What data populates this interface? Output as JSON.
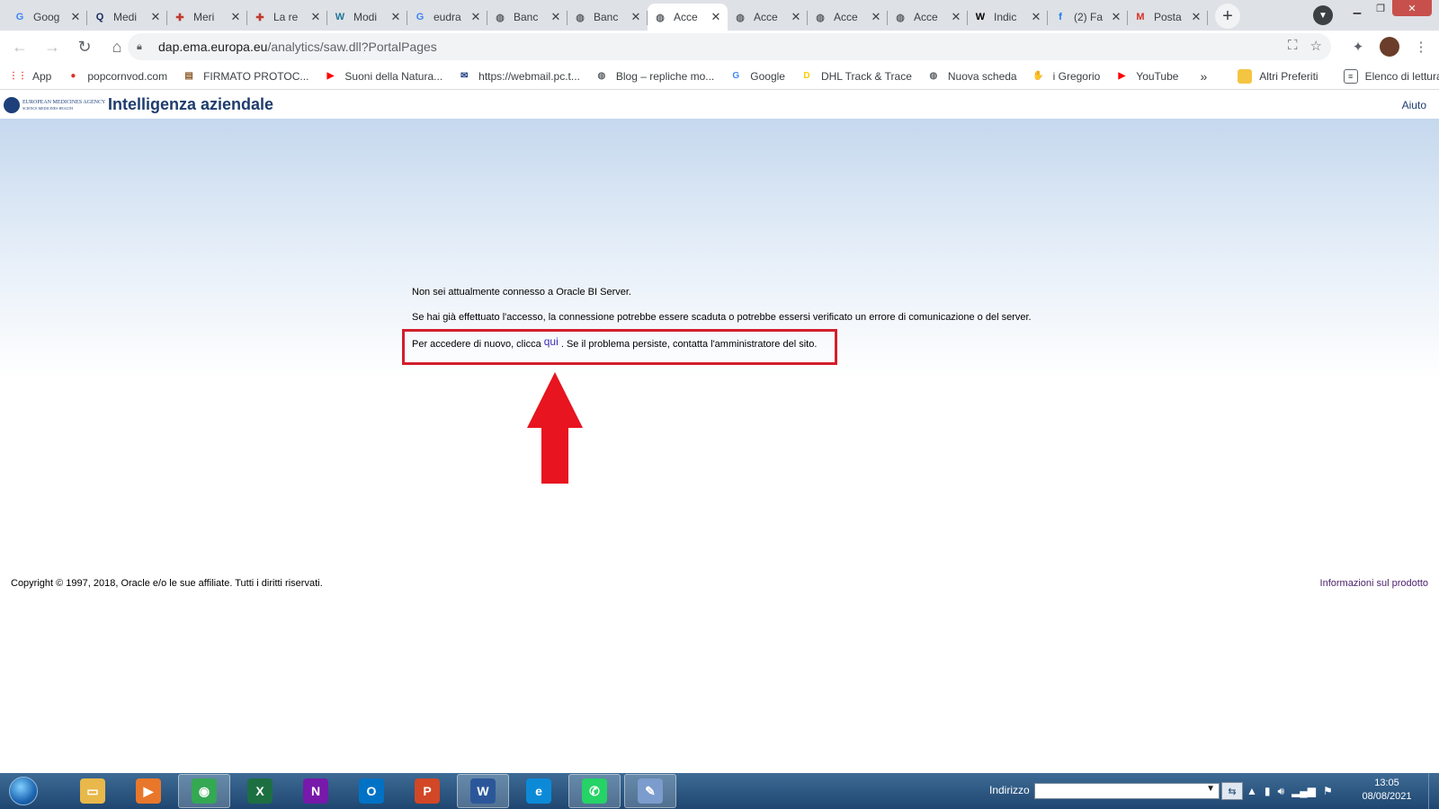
{
  "tabs": [
    {
      "label": "Goog",
      "icon": "google-icon",
      "color": "#4285f4",
      "glyph": "G"
    },
    {
      "label": "Medi",
      "icon": "search-q-icon",
      "color": "#1a2b5e",
      "glyph": "Q"
    },
    {
      "label": "Meri",
      "icon": "ministry-icon",
      "color": "#c0392b",
      "glyph": "✚"
    },
    {
      "label": "La re",
      "icon": "ministry-icon",
      "color": "#c0392b",
      "glyph": "✚"
    },
    {
      "label": "Modi",
      "icon": "wordpress-icon",
      "color": "#21759b",
      "glyph": "W"
    },
    {
      "label": "eudra",
      "icon": "google-icon",
      "color": "#4285f4",
      "glyph": "G"
    },
    {
      "label": "Banc",
      "icon": "globe-icon",
      "color": "#5f6368",
      "glyph": "◍"
    },
    {
      "label": "Banc",
      "icon": "globe-icon",
      "color": "#5f6368",
      "glyph": "◍"
    },
    {
      "label": "Acce",
      "icon": "globe-icon",
      "color": "#5f6368",
      "glyph": "◍",
      "active": true
    },
    {
      "label": "Acce",
      "icon": "globe-icon",
      "color": "#5f6368",
      "glyph": "◍"
    },
    {
      "label": "Acce",
      "icon": "globe-icon",
      "color": "#5f6368",
      "glyph": "◍"
    },
    {
      "label": "Acce",
      "icon": "globe-icon",
      "color": "#5f6368",
      "glyph": "◍"
    },
    {
      "label": "Indic",
      "icon": "wikipedia-icon",
      "color": "#000000",
      "glyph": "W"
    },
    {
      "label": "(2) Fa",
      "icon": "facebook-icon",
      "color": "#1877f2",
      "glyph": "f"
    },
    {
      "label": "Posta",
      "icon": "gmail-icon",
      "color": "#d93025",
      "glyph": "M"
    }
  ],
  "address": {
    "host": "dap.ema.europa.eu",
    "path": "/analytics/saw.dll?PortalPages"
  },
  "bookmarks": [
    {
      "label": "App",
      "icon": "apps-grid-icon",
      "color": "#ea4335",
      "glyph": "⋮⋮"
    },
    {
      "label": "popcornvod.com",
      "icon": "popcorn-icon",
      "color": "#d93025",
      "glyph": "●"
    },
    {
      "label": "FIRMATO PROTOC...",
      "icon": "document-icon",
      "color": "#8b5a2b",
      "glyph": "▤"
    },
    {
      "label": "Suoni della Natura...",
      "icon": "youtube-icon",
      "color": "#ff0000",
      "glyph": "▶"
    },
    {
      "label": "https://webmail.pc.t...",
      "icon": "mail-icon",
      "color": "#1a3a7a",
      "glyph": "✉"
    },
    {
      "label": "Blog – repliche mo...",
      "icon": "globe-icon",
      "color": "#5f6368",
      "glyph": "◍"
    },
    {
      "label": "Google",
      "icon": "google-icon",
      "color": "#4285f4",
      "glyph": "G"
    },
    {
      "label": "DHL Track & Trace",
      "icon": "dhl-icon",
      "color": "#ffcc00",
      "glyph": "D"
    },
    {
      "label": "Nuova scheda",
      "icon": "globe-icon",
      "color": "#5f6368",
      "glyph": "◍"
    },
    {
      "label": "i Gregorio",
      "icon": "hand-icon",
      "color": "#9e9e9e",
      "glyph": "✋"
    },
    {
      "label": "YouTube",
      "icon": "youtube-icon",
      "color": "#ff0000",
      "glyph": "▶"
    }
  ],
  "bookmarks_more": "»",
  "other_favorites": "Altri Preferiti",
  "reading_list": "Elenco di lettura",
  "page": {
    "title": "Intelligenza aziendale",
    "help": "Aiuto",
    "logo_line1": "EUROPEAN MEDICINES AGENCY",
    "logo_line2": "SCIENCE MEDICINES HEALTH",
    "line1": "Non sei attualmente connesso a Oracle BI Server.",
    "line2": "Se hai già effettuato l'accesso, la connessione potrebbe essere scaduta o potrebbe essersi verificato un errore di comunicazione o del server.",
    "line3_pre": "Per accedere di nuovo, clicca",
    "line3_link": "qui",
    "line3_post": ". Se il problema persiste, contatta l'amministratore del sito.",
    "copyright": "Copyright © 1997, 2018, Oracle e/o le sue affiliate. Tutti i diritti riservati.",
    "product_info": "Informazioni sul prodotto"
  },
  "taskbar": {
    "apps": [
      {
        "name": "explorer",
        "icon": "folder-icon",
        "color": "#e8b84a",
        "glyph": "▭"
      },
      {
        "name": "media",
        "icon": "media-player-icon",
        "color": "#e9772b",
        "glyph": "▶"
      },
      {
        "name": "chrome",
        "icon": "chrome-icon",
        "color": "#34a853",
        "glyph": "◉",
        "active": true
      },
      {
        "name": "excel",
        "icon": "excel-icon",
        "color": "#1d6f42",
        "glyph": "X"
      },
      {
        "name": "onenote",
        "icon": "onenote-icon",
        "color": "#7719aa",
        "glyph": "N"
      },
      {
        "name": "outlook",
        "icon": "outlook-icon",
        "color": "#0072c6",
        "glyph": "O"
      },
      {
        "name": "powerpoint",
        "icon": "powerpoint-icon",
        "color": "#d24726",
        "glyph": "P"
      },
      {
        "name": "word",
        "icon": "word-icon",
        "color": "#2b579a",
        "glyph": "W",
        "active": true
      },
      {
        "name": "edge",
        "icon": "edge-icon",
        "color": "#0c8ad8",
        "glyph": "e"
      },
      {
        "name": "whatsapp",
        "icon": "whatsapp-icon",
        "color": "#25d366",
        "glyph": "✆",
        "active": true
      },
      {
        "name": "paint",
        "icon": "paint-icon",
        "color": "#7b9ccc",
        "glyph": "✎",
        "active": true
      }
    ],
    "address_label": "Indirizzo",
    "address_value": "",
    "time": "13:05",
    "date": "08/08/2021"
  },
  "colors": {
    "highlight_box": "#d21f2c",
    "arrow": "#e8141f",
    "title": "#1f3c6d"
  }
}
